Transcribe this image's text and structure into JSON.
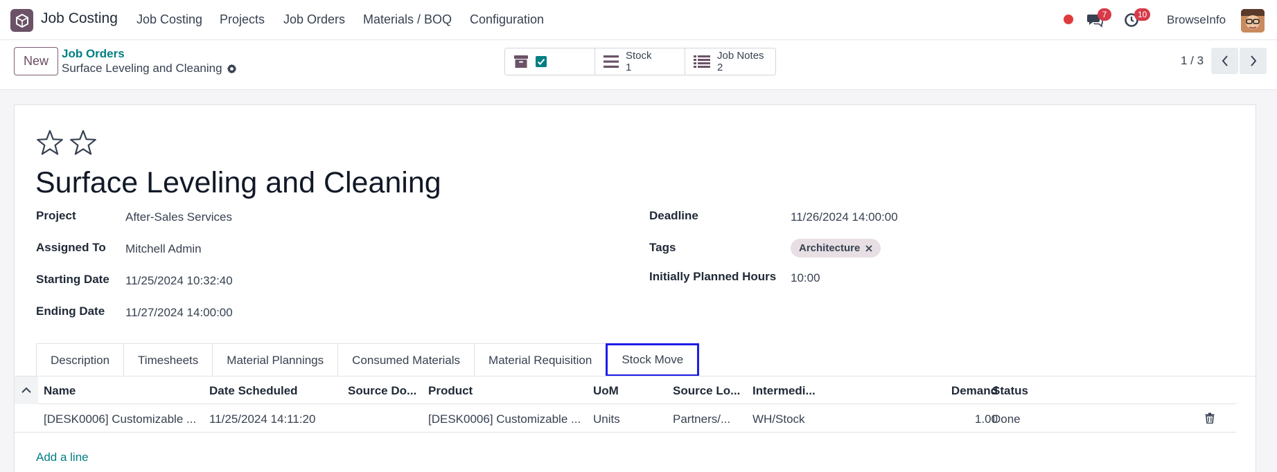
{
  "navbar": {
    "app_name": "Job Costing",
    "menu": [
      "Job Costing",
      "Projects",
      "Job Orders",
      "Materials / BOQ",
      "Configuration"
    ],
    "messages_count": "7",
    "activities_count": "10",
    "company": "BrowseInfo"
  },
  "control": {
    "new_label": "New",
    "breadcrumb_parent": "Job Orders",
    "breadcrumb_current": "Surface Leveling and Cleaning",
    "smart_buttons": [
      {
        "label": "",
        "value": ""
      },
      {
        "label": "Stock",
        "value": "1"
      },
      {
        "label": "Job Notes",
        "value": "2"
      }
    ],
    "pager": "1 / 3"
  },
  "form": {
    "title": "Surface Leveling and Cleaning",
    "project_label": "Project",
    "project_value": "After-Sales Services",
    "assigned_label": "Assigned To",
    "assigned_value": "Mitchell Admin",
    "start_label": "Starting Date",
    "start_value": "11/25/2024 10:32:40",
    "end_label": "Ending Date",
    "end_value": "11/27/2024 14:00:00",
    "deadline_label": "Deadline",
    "deadline_value": "11/26/2024 14:00:00",
    "tags_label": "Tags",
    "tag": "Architecture",
    "hours_label": "Initially Planned Hours",
    "hours_value": "10:00"
  },
  "tabs": [
    "Description",
    "Timesheets",
    "Material Plannings",
    "Consumed Materials",
    "Material Requisition",
    "Stock Move"
  ],
  "active_tab": "Stock Move",
  "table": {
    "headers": [
      "Name",
      "Date Scheduled",
      "Source Do...",
      "Product",
      "UoM",
      "Source Lo...",
      "Intermedi...",
      "Demand",
      "Status"
    ],
    "rows": [
      [
        "[DESK0006] Customizable ...",
        "11/25/2024 14:11:20",
        "",
        "[DESK0006] Customizable ...",
        "Units",
        "Partners/...",
        "WH/Stock",
        "1.00",
        "Done"
      ]
    ],
    "add_line": "Add a line"
  },
  "colors": {
    "brand": "#6b5267",
    "link": "#017e84",
    "active_tab_border": "#1c1ce6",
    "badge": "#d63a49"
  }
}
